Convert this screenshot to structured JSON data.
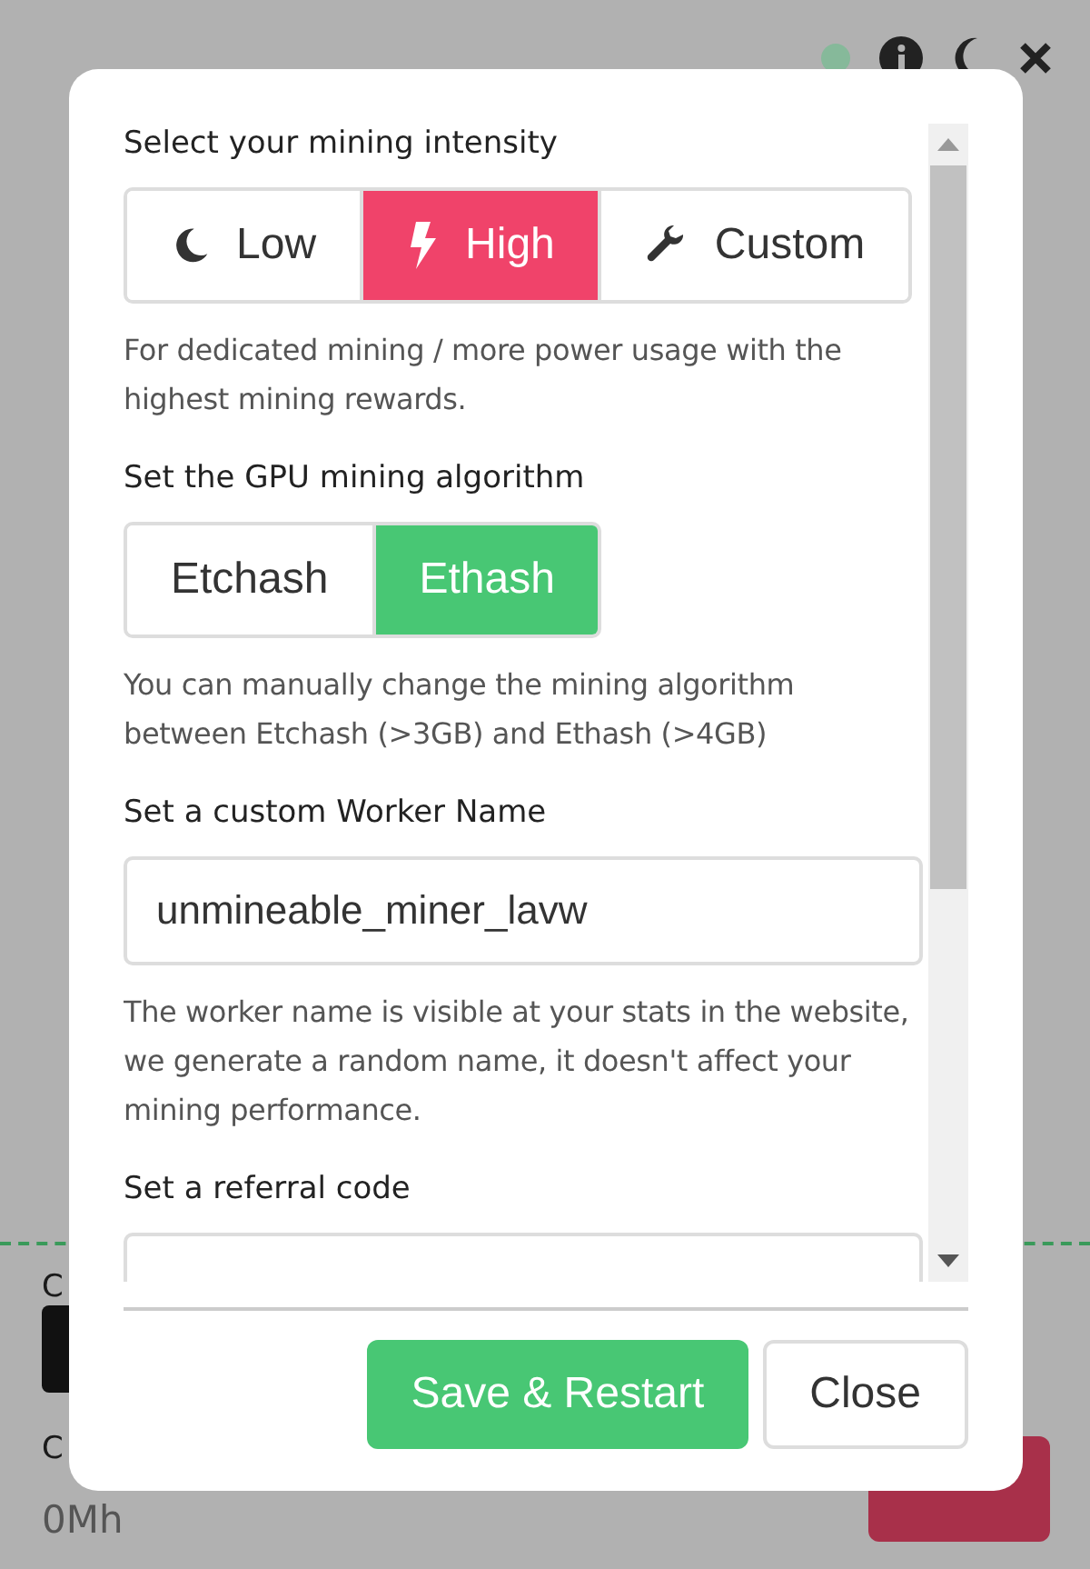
{
  "background": {
    "labels": [
      "C",
      "C"
    ],
    "reading": "0Mh"
  },
  "dialog": {
    "intensity": {
      "label": "Select your mining intensity",
      "options": [
        {
          "kind": "low",
          "label": "Low",
          "selected": false
        },
        {
          "kind": "high",
          "label": "High",
          "selected": true
        },
        {
          "kind": "custom",
          "label": "Custom",
          "selected": false
        }
      ],
      "description": "For dedicated mining / more power usage with the highest mining rewards."
    },
    "algorithm": {
      "label": "Set the GPU mining algorithm",
      "options": [
        {
          "label": "Etchash",
          "selected": false
        },
        {
          "label": "Ethash",
          "selected": true
        }
      ],
      "description": "You can manually change the mining algorithm between Etchash (>3GB) and Ethash (>4GB)"
    },
    "worker": {
      "label": "Set a custom Worker Name",
      "value": "unmineable_miner_lavw",
      "description": "The worker name is visible at your stats in the website, we generate a random name, it doesn't affect your mining performance."
    },
    "referral": {
      "label": "Set a referral code"
    },
    "buttons": [
      {
        "kind": "primary",
        "label": "Save & Restart"
      },
      {
        "kind": "secondary",
        "label": "Close"
      }
    ]
  }
}
